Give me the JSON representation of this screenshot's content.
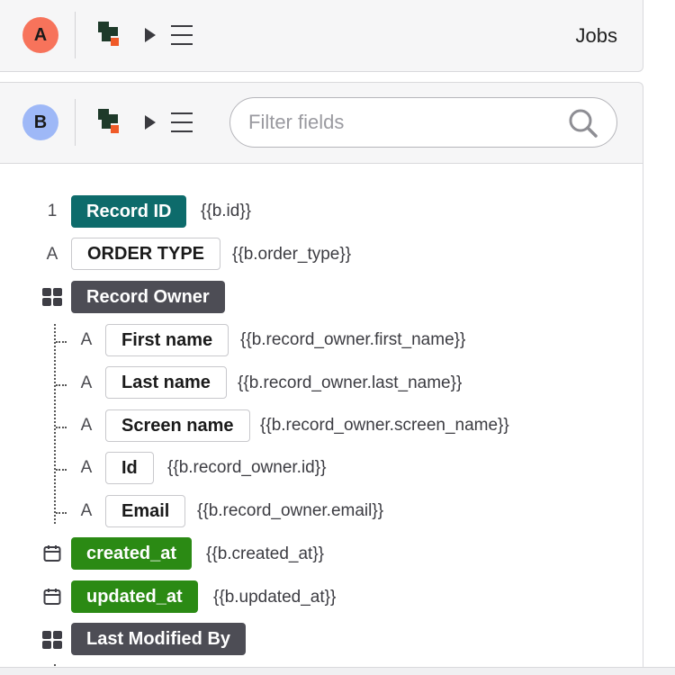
{
  "card_a": {
    "avatar": "A",
    "title": "Jobs",
    "avatar_color": "#f7735b"
  },
  "card_b": {
    "avatar": "B",
    "avatar_color": "#9eb8f7",
    "filter": {
      "placeholder": "Filter fields",
      "value": ""
    }
  },
  "icons": {
    "logo": "logo-icon",
    "play": "play-icon",
    "menu": "menu-icon",
    "search": "search-icon",
    "group": "grid-icon",
    "date": "calendar-icon"
  },
  "colors": {
    "id_chip": "#0d6b6b",
    "group_chip": "#4d4d55",
    "date_chip": "#2b8a14"
  },
  "fields": {
    "record_id": {
      "type": "1",
      "label": "Record ID",
      "path": "{{b.id}}"
    },
    "order_type": {
      "type": "A",
      "label": "ORDER TYPE",
      "path": "{{b.order_type}}"
    },
    "record_owner": {
      "label": "Record Owner"
    },
    "first_name": {
      "type": "A",
      "label": "First name",
      "path": "{{b.record_owner.first_name}}"
    },
    "last_name": {
      "type": "A",
      "label": "Last name",
      "path": "{{b.record_owner.last_name}}"
    },
    "screen_name": {
      "type": "A",
      "label": "Screen name",
      "path": "{{b.record_owner.screen_name}}"
    },
    "owner_id": {
      "type": "A",
      "label": "Id",
      "path": "{{b.record_owner.id}}"
    },
    "email": {
      "type": "A",
      "label": "Email",
      "path": "{{b.record_owner.email}}"
    },
    "created_at": {
      "label": "created_at",
      "path": "{{b.created_at}}"
    },
    "updated_at": {
      "label": "updated_at",
      "path": "{{b.updated_at}}"
    },
    "last_modified_by": {
      "label": "Last Modified By"
    }
  }
}
